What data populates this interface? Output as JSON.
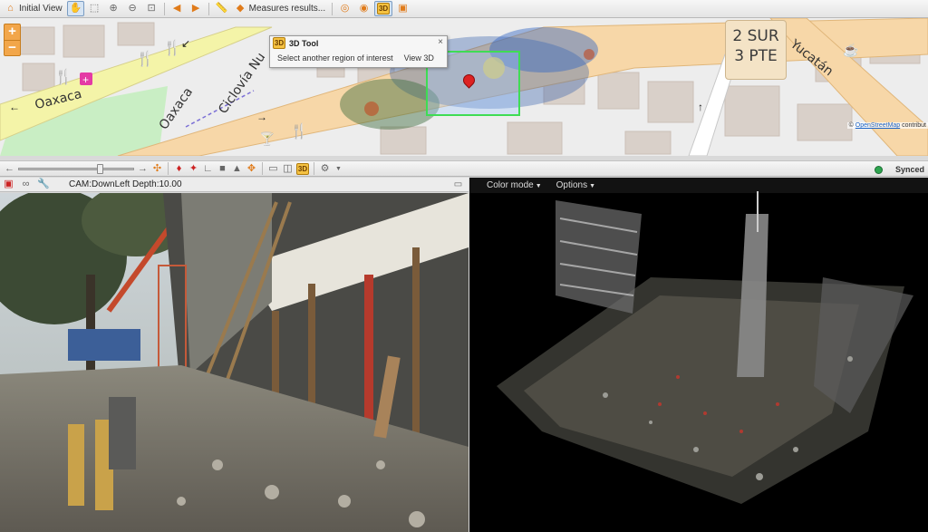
{
  "toolbar": {
    "initial_view_label": "Initial View",
    "measures_label": "Measures results...",
    "badge_3d": "3D"
  },
  "map": {
    "streets": {
      "oaxaca_left": "Oaxaca",
      "oaxaca_right": "Oaxaca",
      "ciclovia": "Ciclovía Nu",
      "yucatan": "Yucatán"
    },
    "sign": {
      "line1": "2 SUR",
      "line2": "3 PTE"
    },
    "attribution_prefix": "© ",
    "attribution_link": "OpenStreetMap",
    "attribution_suffix": " contribut",
    "zoom_in": "+",
    "zoom_out": "−"
  },
  "tool_popup": {
    "title": "3D Tool",
    "message": "Select another region of interest",
    "action": "View 3D",
    "close": "×"
  },
  "sec_toolbar": {
    "status": "Synced",
    "badge_3d": "3D",
    "slider_value": 0.72
  },
  "camera": {
    "label": "CAM:DownLeft Depth:10.00"
  },
  "pointcloud": {
    "color_mode": "Color mode",
    "options": "Options"
  },
  "colors": {
    "map_bg": "#ededed",
    "main_road": "#f7d7a8",
    "secondary_road": "#f4f4a8",
    "park": "#c9eec4",
    "roi_border": "#3fdc54",
    "zoom_orange": "#f2a64a"
  }
}
